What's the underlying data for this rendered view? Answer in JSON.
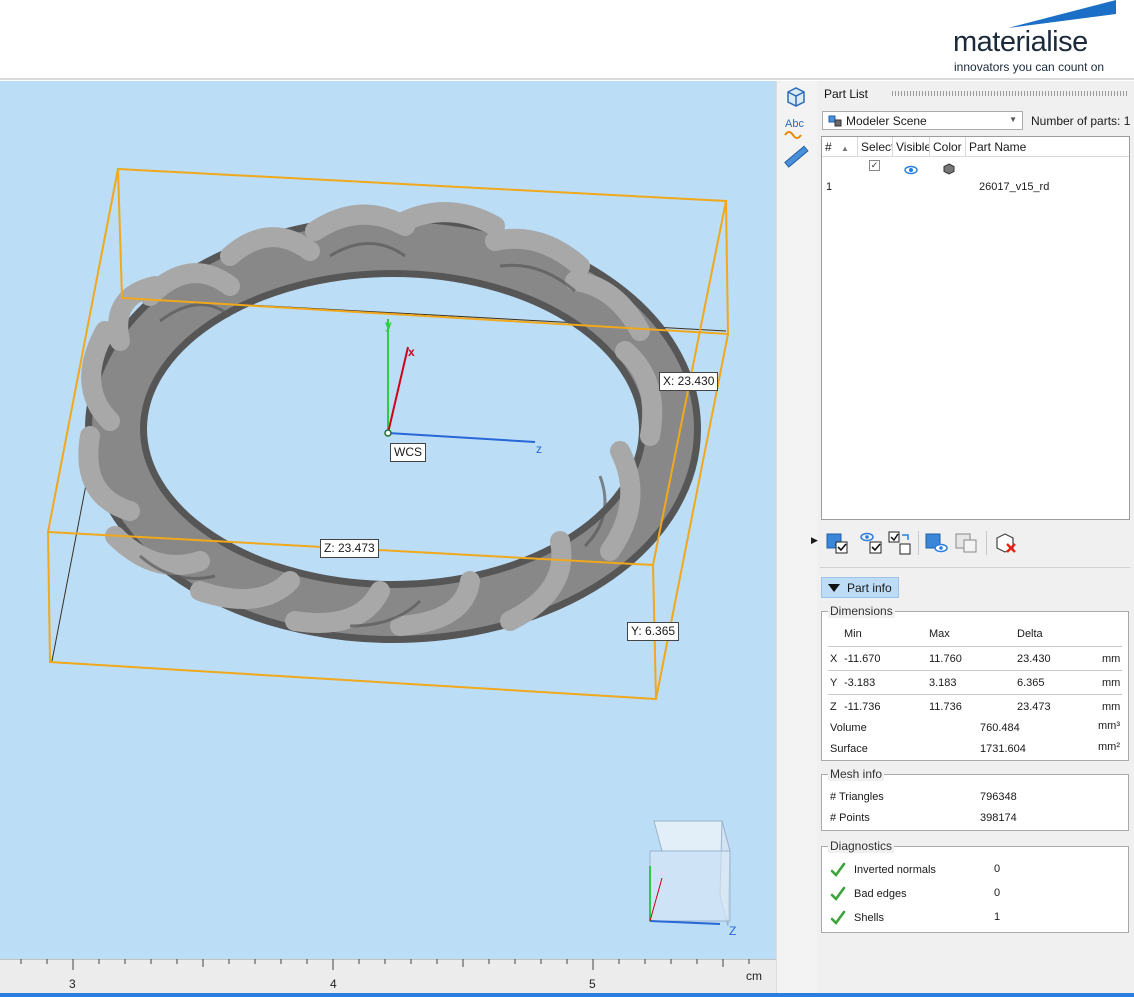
{
  "brand": {
    "name": "materialise",
    "tagline": "innovators you can count on"
  },
  "viewport": {
    "wcs_label": "WCS",
    "axis_x": "x",
    "axis_y": "y",
    "axis_z": "z",
    "dim_x": "X: 23.430",
    "dim_y": "Y: 6.365",
    "dim_z": "Z: 23.473",
    "nav_cube_axis": "Z",
    "ruler": {
      "ticks": [
        "3",
        "4",
        "5"
      ],
      "unit": "cm"
    }
  },
  "tools": [
    "part-list-icon",
    "text-abc-icon",
    "measure-ruler-icon"
  ],
  "part_list": {
    "title": "Part List",
    "scene": "Modeler Scene",
    "num_parts_label": "Number of parts:",
    "num_parts": "1",
    "columns": [
      "#",
      "Select",
      "Visible",
      "Color",
      "Part Name"
    ],
    "rows": [
      {
        "index": "1",
        "selected": true,
        "visible": true,
        "name": "26017_v15_rd"
      }
    ]
  },
  "part_info": {
    "toggle_label": "Part info",
    "dimensions": {
      "legend": "Dimensions",
      "headers": [
        "Min",
        "Max",
        "Delta"
      ],
      "rows": [
        {
          "axis": "X",
          "min": "-11.670",
          "max": "11.760",
          "delta": "23.430",
          "unit": "mm"
        },
        {
          "axis": "Y",
          "min": "-3.183",
          "max": "3.183",
          "delta": "6.365",
          "unit": "mm"
        },
        {
          "axis": "Z",
          "min": "-11.736",
          "max": "11.736",
          "delta": "23.473",
          "unit": "mm"
        }
      ],
      "volume_label": "Volume",
      "volume": "760.484",
      "volume_unit": "mm³",
      "surface_label": "Surface",
      "surface": "1731.604",
      "surface_unit": "mm²"
    },
    "mesh": {
      "legend": "Mesh info",
      "triangles_label": "# Triangles",
      "triangles": "796348",
      "points_label": "# Points",
      "points": "398174"
    },
    "diagnostics": {
      "legend": "Diagnostics",
      "items": [
        {
          "label": "Inverted normals",
          "value": "0"
        },
        {
          "label": "Bad edges",
          "value": "0"
        },
        {
          "label": "Shells",
          "value": "1"
        }
      ]
    }
  },
  "colors": {
    "viewport_bg": "#bcddf6",
    "bbox": "#f0a81c",
    "accent": "#2b7de0",
    "check": "#3aa53a"
  }
}
